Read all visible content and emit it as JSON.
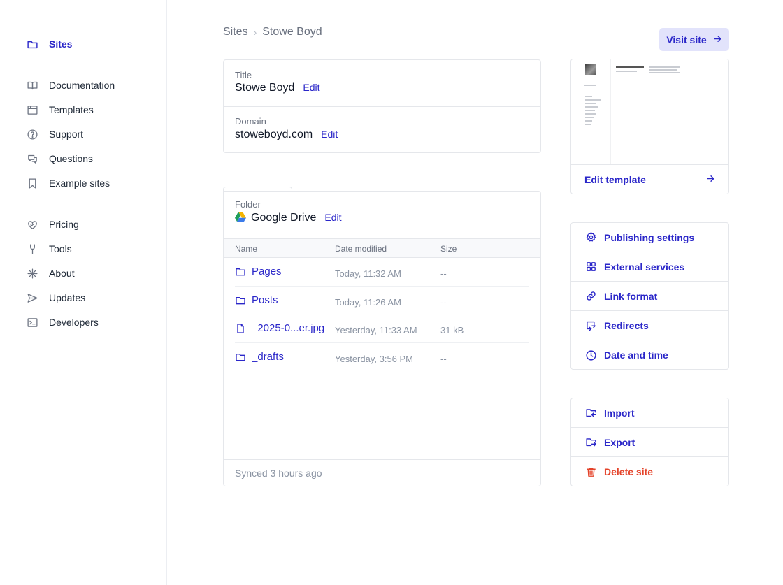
{
  "sidebar": {
    "items": [
      {
        "label": "Sites",
        "icon": "folder-icon"
      },
      {
        "label": "Documentation",
        "icon": "book-icon"
      },
      {
        "label": "Templates",
        "icon": "template-icon"
      },
      {
        "label": "Support",
        "icon": "help-circle-icon"
      },
      {
        "label": "Questions",
        "icon": "chat-icon"
      },
      {
        "label": "Example sites",
        "icon": "bookmark-icon"
      },
      {
        "label": "Pricing",
        "icon": "heart-hand-icon"
      },
      {
        "label": "Tools",
        "icon": "tools-icon"
      },
      {
        "label": "About",
        "icon": "asterisk-icon"
      },
      {
        "label": "Updates",
        "icon": "send-icon"
      },
      {
        "label": "Developers",
        "icon": "terminal-icon"
      }
    ]
  },
  "breadcrumb": {
    "root": "Sites",
    "current": "Stowe Boyd"
  },
  "visit_button": "Visit site",
  "info": {
    "title_label": "Title",
    "title_value": "Stowe Boyd",
    "domain_label": "Domain",
    "domain_value": "stoweboyd.com",
    "edit_label": "Edit"
  },
  "folder": {
    "label": "Folder",
    "source": "Google Drive",
    "edit_label": "Edit",
    "columns": {
      "name": "Name",
      "date": "Date modified",
      "size": "Size"
    },
    "rows": [
      {
        "name": "Pages",
        "date": "Today, 11:32 AM",
        "size": "--",
        "kind": "folder"
      },
      {
        "name": "Posts",
        "date": "Today, 11:26 AM",
        "size": "--",
        "kind": "folder"
      },
      {
        "name": "_2025-0...er.jpg",
        "date": "Yesterday, 11:33 AM",
        "size": "31 kB",
        "kind": "file"
      },
      {
        "name": "_drafts",
        "date": "Yesterday, 3:56 PM",
        "size": "--",
        "kind": "folder"
      }
    ],
    "footer": "Synced 3 hours ago"
  },
  "preview": {
    "edit_template": "Edit template"
  },
  "settings_actions": [
    {
      "label": "Publishing settings",
      "icon": "gear-icon"
    },
    {
      "label": "External services",
      "icon": "grid-icon"
    },
    {
      "label": "Link format",
      "icon": "link-icon"
    },
    {
      "label": "Redirects",
      "icon": "redirect-icon"
    },
    {
      "label": "Date and time",
      "icon": "clock-icon"
    }
  ],
  "data_actions": [
    {
      "label": "Import",
      "icon": "folder-import-icon"
    },
    {
      "label": "Export",
      "icon": "folder-export-icon"
    },
    {
      "label": "Delete site",
      "icon": "trash-icon"
    }
  ],
  "colors": {
    "accent": "#2b27c9",
    "danger": "#e4432a",
    "accent_bg": "#e2e3fb"
  }
}
